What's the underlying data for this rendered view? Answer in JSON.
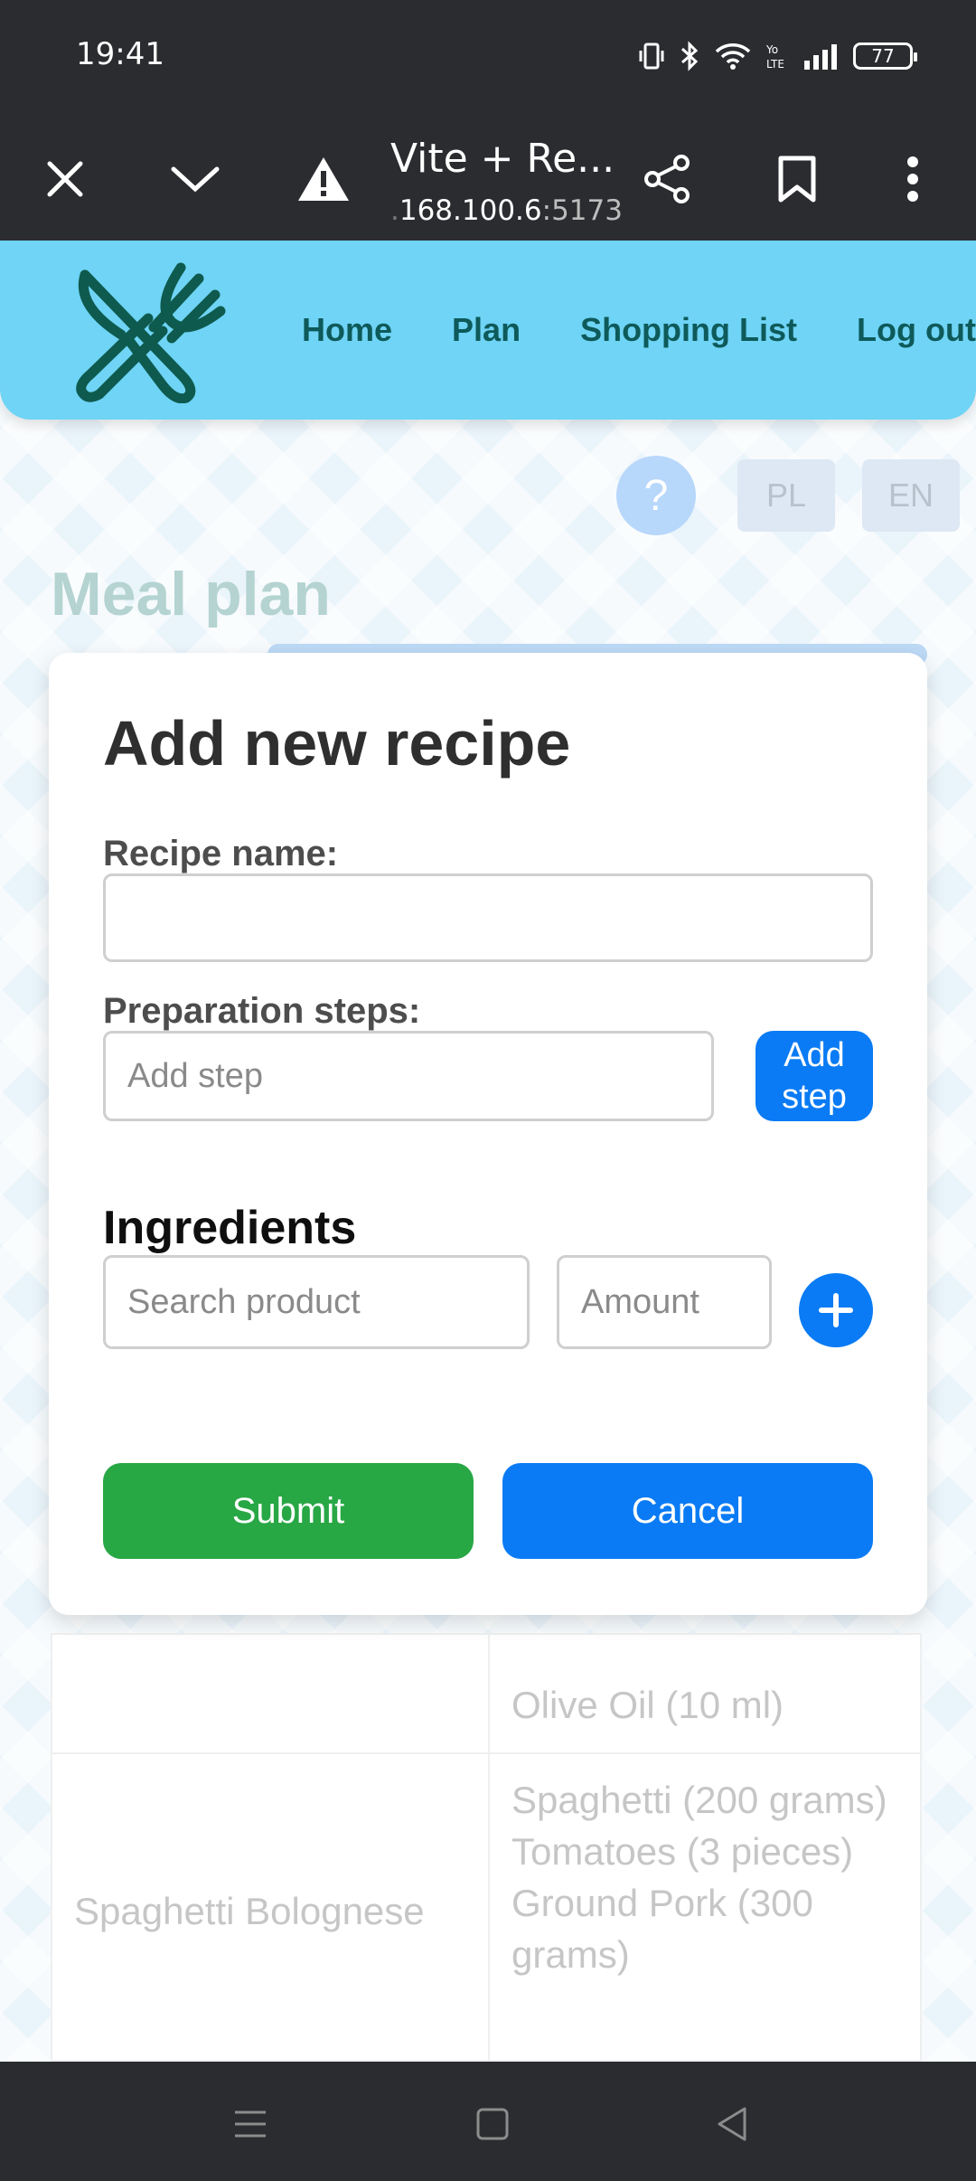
{
  "status_bar": {
    "time": "19:41",
    "battery": "77"
  },
  "browser": {
    "tab_title": "Vite + Re...",
    "url_dim": ".",
    "url_main": "168.100.6",
    "url_port": ":5173"
  },
  "nav": {
    "links": [
      "Home",
      "Plan",
      "Shopping List",
      "Log out"
    ]
  },
  "lang": {
    "help": "?",
    "pl": "PL",
    "en": "EN"
  },
  "page": {
    "title": "Meal plan"
  },
  "modal": {
    "title": "Add new recipe",
    "recipe_name_label": "Recipe name:",
    "recipe_name_value": "",
    "steps_label": "Preparation steps:",
    "step_placeholder": "Add step",
    "add_step_label": "Add step",
    "ingredients_title": "Ingredients",
    "search_placeholder": "Search product",
    "amount_placeholder": "Amount",
    "submit_label": "Submit",
    "cancel_label": "Cancel"
  },
  "table": {
    "rows": [
      {
        "name": "",
        "ingredients": [
          "Olive Oil (10 ml)"
        ]
      },
      {
        "name": "Spaghetti Bolognese",
        "ingredients": [
          "Spaghetti (200 grams)",
          "Tomatoes (3 pieces)",
          "Ground Pork (300 grams)"
        ]
      }
    ]
  },
  "colors": {
    "nav_bg": "#6fd4f5",
    "primary": "#0a7bf4",
    "success": "#28a745",
    "system_bar": "#2b2c30"
  },
  "icons": [
    "close-icon",
    "chevron-down-icon",
    "warning-icon",
    "share-icon",
    "bookmark-icon",
    "more-vert-icon",
    "plus-icon",
    "menu-icon",
    "home-square-icon",
    "back-triangle-icon"
  ]
}
